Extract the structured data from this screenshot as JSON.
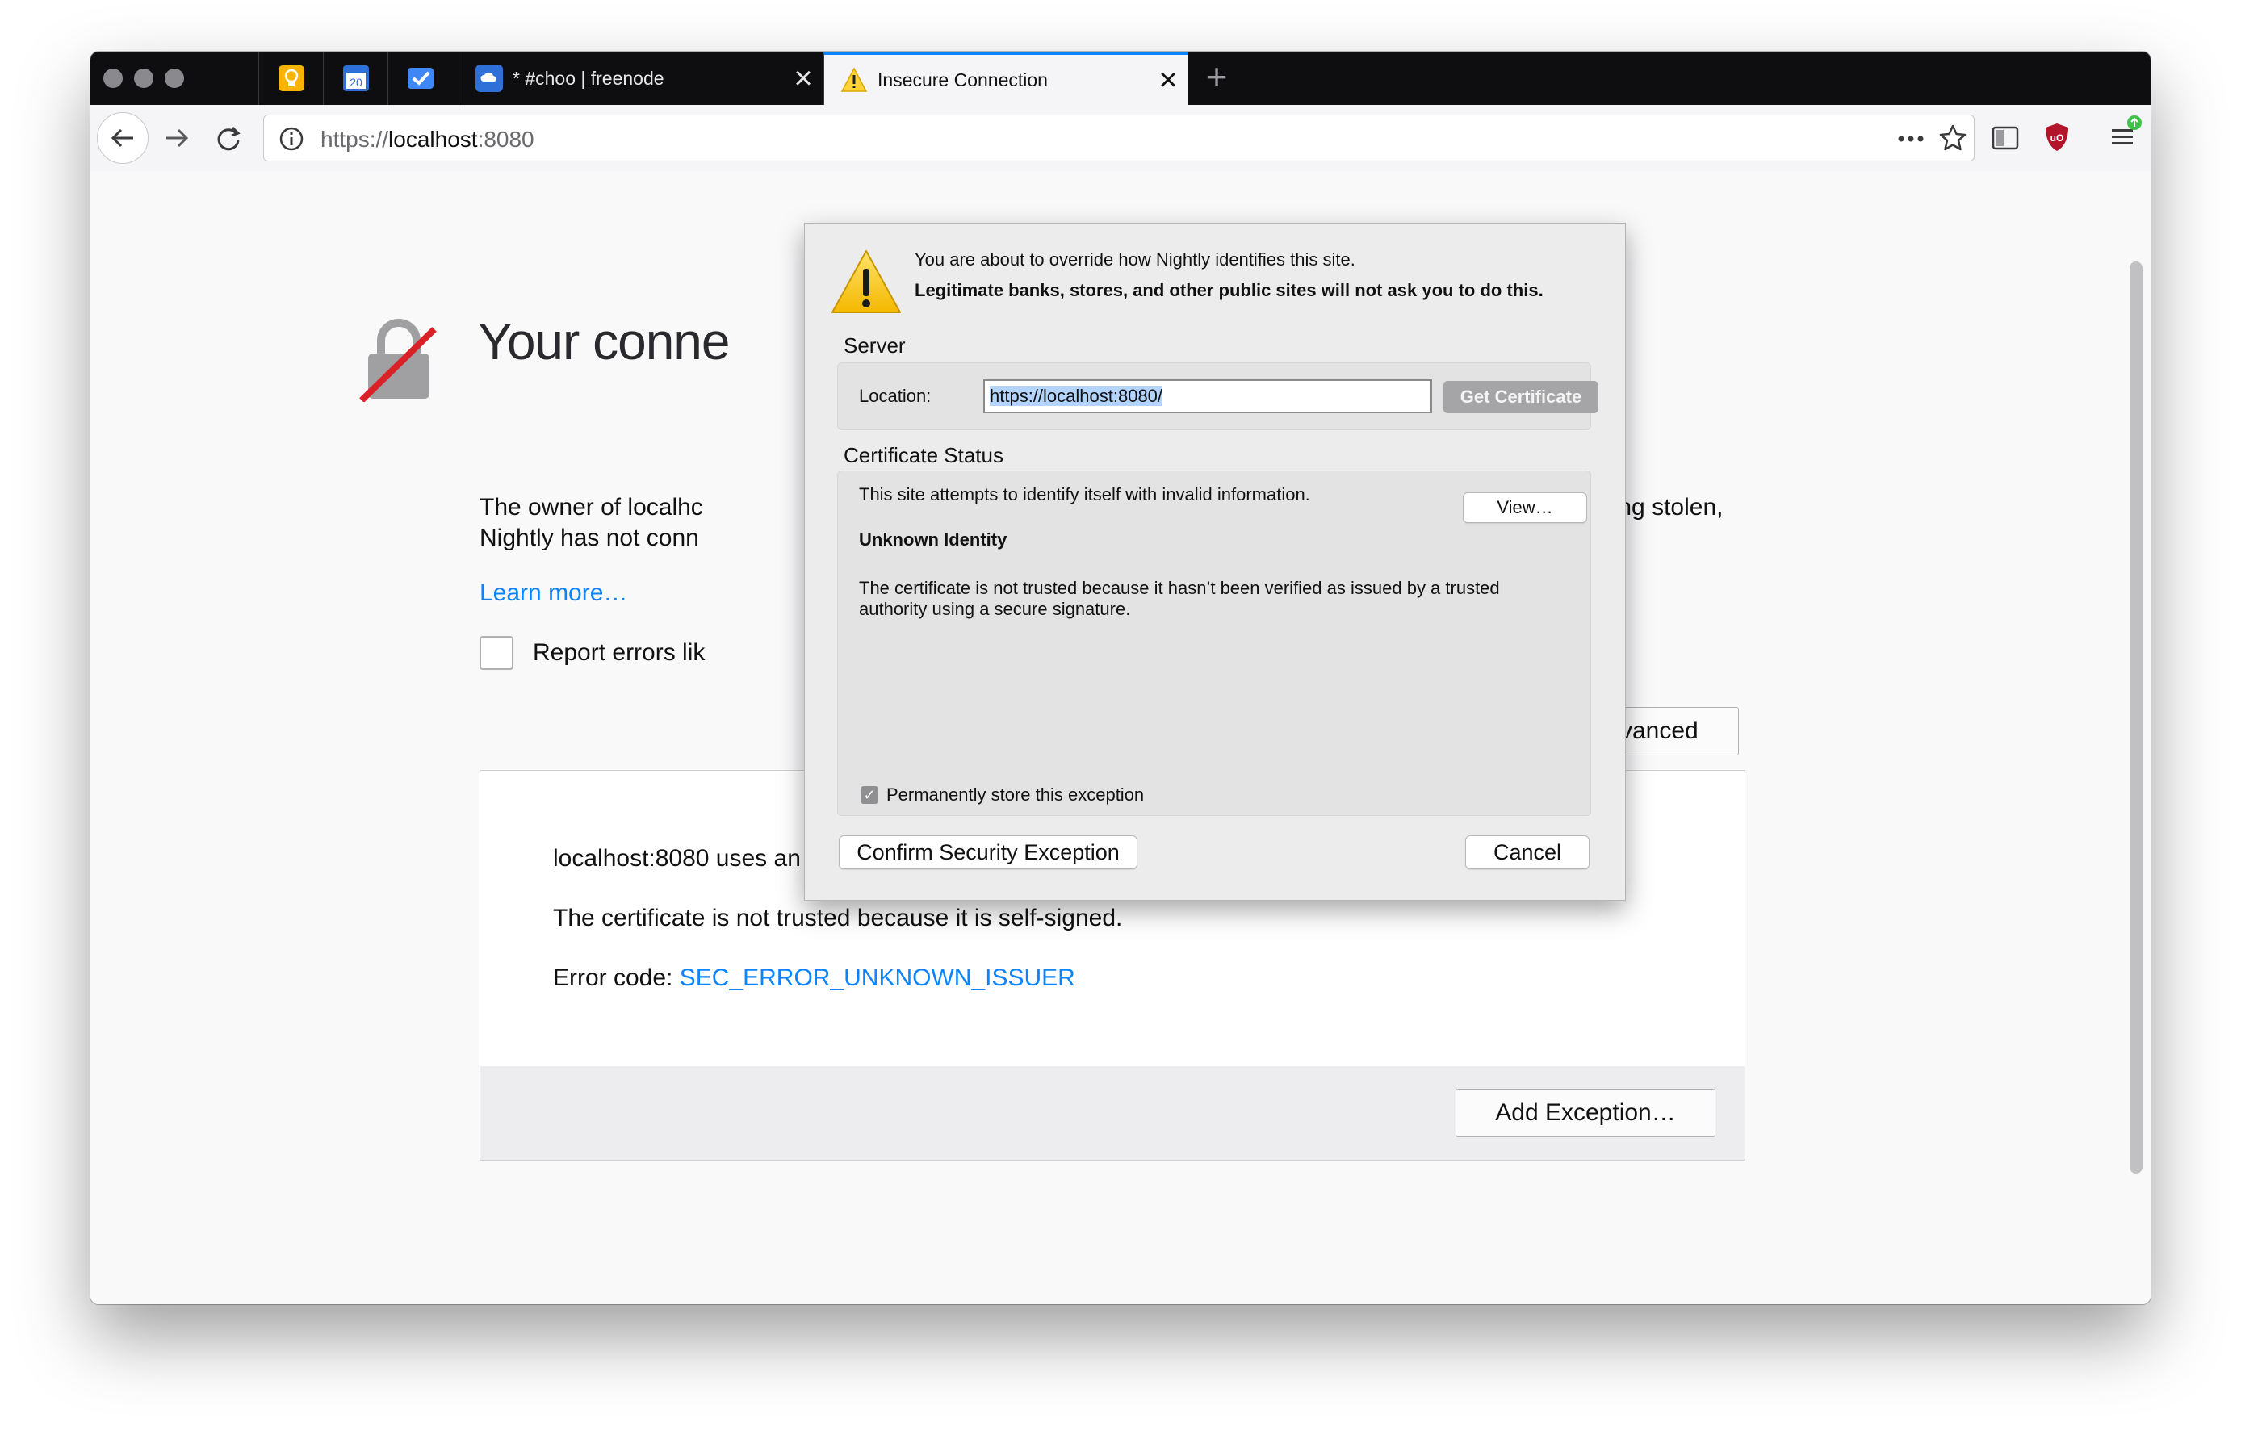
{
  "browser": {
    "tabs": [
      {
        "title": "* #choo | freenode",
        "active": false
      },
      {
        "title": "Insecure Connection",
        "active": true
      }
    ],
    "pinned_tab_icons": [
      "lightbulb-icon",
      "calendar-icon",
      "tasks-icon",
      "cloud-icon"
    ],
    "calendar_day": "20",
    "url": {
      "scheme": "https://",
      "host": "localhost",
      "port": ":8080"
    }
  },
  "error_page": {
    "title": "Your conne",
    "body_line1_left": "The owner of localhc",
    "body_line1_right": "from being stolen,",
    "body_line2_left": "Nightly has not conn",
    "learn_more": "Learn more…",
    "report_label": "Report errors lik",
    "advanced_button": "Advanced",
    "advanced_panel": {
      "line1": "localhost:8080 uses an invalid security certificate.",
      "line2": "The certificate is not trusted because it is self-signed.",
      "error_code_label": "Error code: ",
      "error_code": "SEC_ERROR_UNKNOWN_ISSUER",
      "add_exception_button": "Add Exception…"
    }
  },
  "dialog": {
    "intro": "You are about to override how Nightly identifies this site.",
    "warning": "Legitimate banks, stores, and other public sites will not ask you to do this.",
    "server_heading": "Server",
    "location_label": "Location:",
    "location_value": "https://localhost:8080/",
    "get_certificate_button": "Get Certificate",
    "status_heading": "Certificate Status",
    "status_text": "This site attempts to identify itself with invalid information.",
    "view_button": "View…",
    "identity_heading": "Unknown Identity",
    "identity_line1": "The certificate is not trusted because it hasn’t been verified as issued by a trusted",
    "identity_line2": "authority using a secure signature.",
    "permanent_label": "Permanently store this exception",
    "permanent_checked": true,
    "confirm_button": "Confirm Security Exception",
    "cancel_button": "Cancel"
  }
}
